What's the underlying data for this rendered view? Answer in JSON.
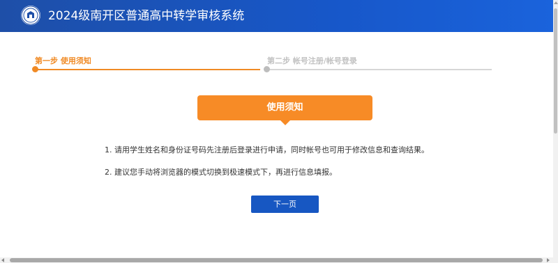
{
  "header": {
    "title": "2024级南开区普通高中转学审核系统",
    "logo_icon": "school-emblem-icon",
    "background_color": "#1757c9"
  },
  "steps": [
    {
      "label": "第一步 使用须知",
      "state": "active",
      "color": "#f08a25"
    },
    {
      "label": "第二步 帐号注册/帐号登录",
      "state": "inactive",
      "color": "#c2c2c2"
    }
  ],
  "notice": {
    "title": "使用须知",
    "items": [
      "1. 请用学生姓名和身份证号码先注册后登录进行申请，同时帐号也可用于修改信息和查询结果。",
      "2. 建议您手动将浏览器的模式切换到极速模式下，再进行信息填报。"
    ],
    "accent_color": "#f78b26"
  },
  "actions": {
    "next_label": "下一页",
    "button_color": "#1757c2"
  }
}
